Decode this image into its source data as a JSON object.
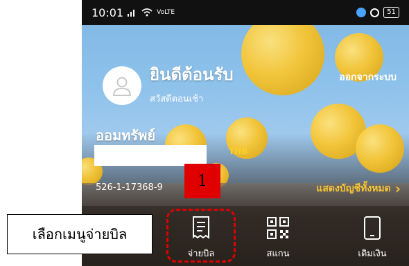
{
  "status_bar": {
    "time": "10:01",
    "network": "VoLTE",
    "battery": "51"
  },
  "header": {
    "welcome": "ยินดีต้อนรับ",
    "greeting": "สวัสดีตอนเช้า",
    "logout_label": "ออกจากระบบ"
  },
  "account": {
    "type": "ออมทรัพย์",
    "balance": "",
    "currency": "THB",
    "number": "526-1-17368-9",
    "show_all_label": "แสดงบัญชีทั้งหมด"
  },
  "menu": {
    "pay_bill": "จ่ายบิล",
    "scan": "สแกน",
    "top_up": "เติมเงิน"
  },
  "annotation": {
    "step_number": "1",
    "callout_text": "เลือกเมนูจ่ายบิล",
    "highlight_color": "#e00000"
  },
  "colors": {
    "accent_yellow": "#f7c531"
  }
}
